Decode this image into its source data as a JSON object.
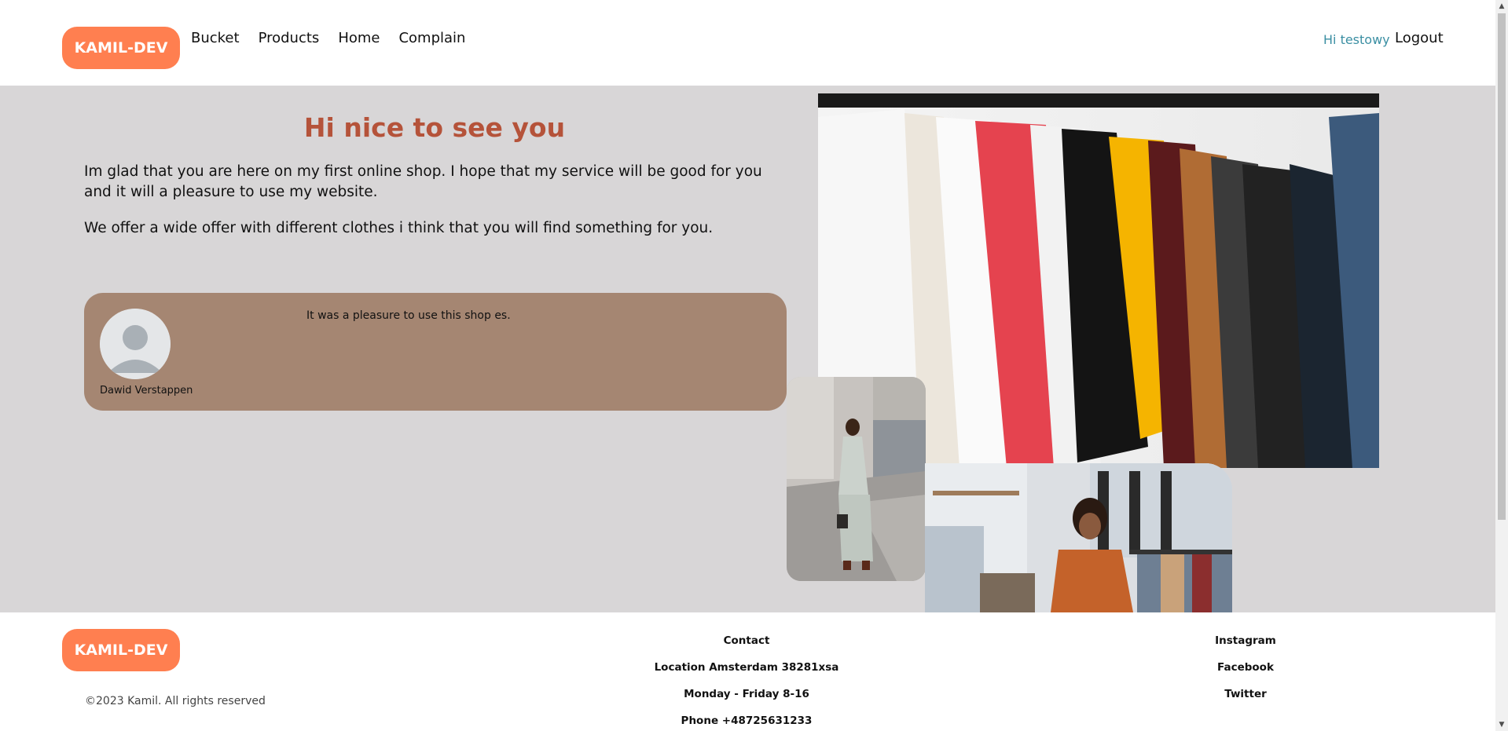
{
  "header": {
    "logo": "KAMIL-DEV",
    "nav": [
      "Bucket",
      "Products",
      "Home",
      "Complain"
    ],
    "greeting": "Hi testowy",
    "logout": "Logout"
  },
  "hero": {
    "title": "Hi nice to see you",
    "paragraph1": "Im glad that you are here on my first online shop.  I hope that my service will be good for you and it will a pleasure to use my website.",
    "paragraph2": "We offer a wide offer with different clothes i think that you will find something for you."
  },
  "review": {
    "name": "Dawid Verstappen",
    "text": "It was a pleasure to use this shop es."
  },
  "footer": {
    "logo": "KAMIL-DEV",
    "copyright": "©2023 Kamil. All rights reserved",
    "contact": [
      "Contact",
      "Location Amsterdam 38281xsa",
      "Monday - Friday 8-16",
      "Phone +48725631233"
    ],
    "social": [
      "Instagram",
      "Facebook",
      "Twitter"
    ]
  },
  "colors": {
    "brand": "#ff7f50",
    "hero_bg": "#d8d6d7",
    "title": "#b5533a",
    "review_bg": "#a58672",
    "greeting": "#3b8fa3"
  }
}
